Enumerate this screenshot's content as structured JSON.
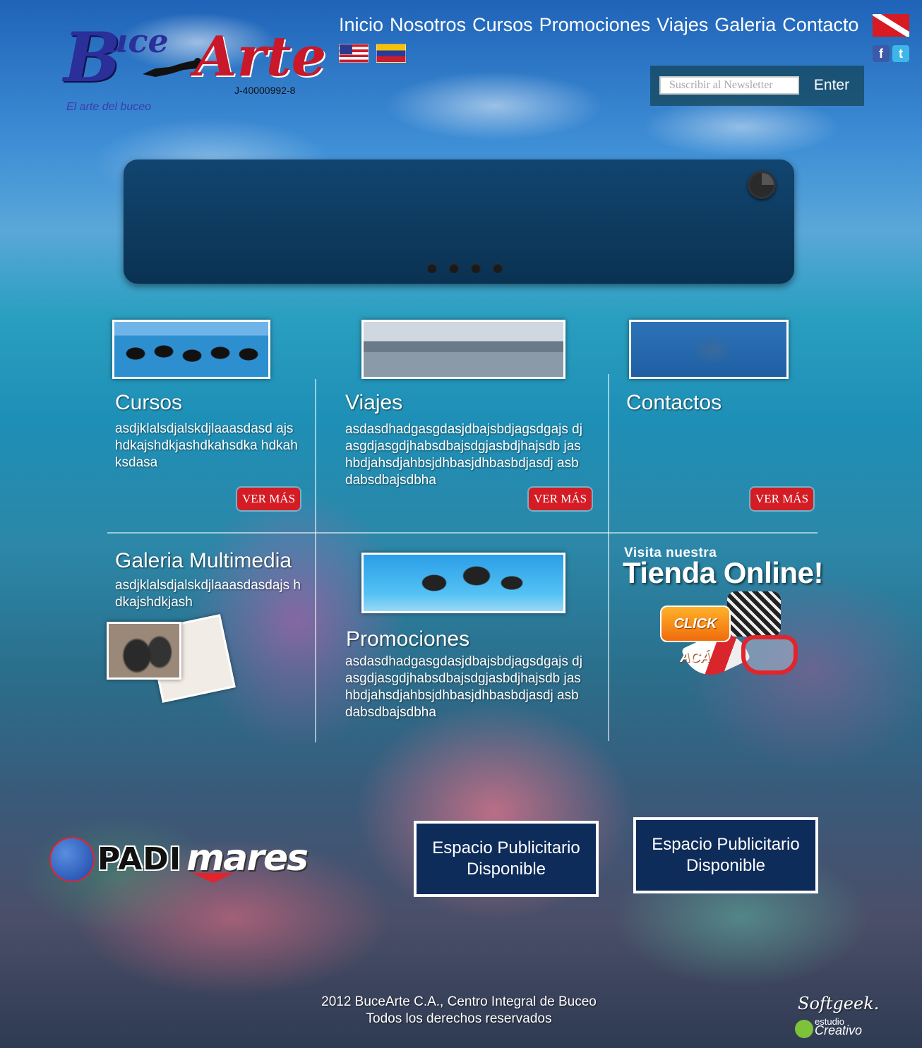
{
  "logo": {
    "brand_b": "B",
    "brand_uce": "uce",
    "brand_arte": "Arte",
    "rif": "J-40000992-8",
    "tagline": "El arte del buceo"
  },
  "nav": [
    "Inicio",
    "Nosotros",
    "Cursos",
    "Promociones",
    "Viajes",
    "Galeria",
    "Contacto"
  ],
  "social": {
    "facebook": "f",
    "twitter": "t"
  },
  "newsletter": {
    "placeholder": "Suscribir al Newsletter",
    "button": "Enter"
  },
  "slider": {
    "dots": 4
  },
  "sections": {
    "cursos": {
      "title": "Cursos",
      "text": "asdjklalsdjalskdjlaaasdasd ajshdkajshdkjashdkahsdka hdkahksdasa",
      "button": "VER MÁS"
    },
    "viajes": {
      "title": "Viajes",
      "text": "asdasdhadgasgdasjdbajsbdjagsdgajs djasgdjasgdjhabsdbajsdgjasbdjhajsdb jashbdjahsdjahbsjdhbasjdhbasbdjasdj asbdabsdbajsdbha",
      "button": "VER MÁS"
    },
    "contactos": {
      "title": "Contactos",
      "button": "VER MÁS"
    },
    "galeria": {
      "title": "Galeria Multimedia",
      "text": "asdjklalsdjalskdjlaaasdasdajs hdkajshdkjash"
    },
    "promociones": {
      "title": "Promociones",
      "text": "asdasdhadgasgdasjdbajsbdjagsdgajs djasgdjasgdjhabsdbajsdgjasbdjhajsdb jashbdjahsdjahbsjdhbasjdhbasbdjasdj asbdabsdbajsdbha"
    }
  },
  "tienda": {
    "small": "Visita nuestra",
    "big": "Tienda Online!",
    "click": "CLICK ACÁ"
  },
  "sponsors": {
    "padi": "PADI",
    "mares": "mares"
  },
  "ads": [
    "Espacio Publicitario Disponible",
    "Espacio Publicitario Disponible"
  ],
  "footer": {
    "line1": "2012 BuceArte C.A., Centro Integral de Buceo",
    "line2": "Todos los derechos reservados"
  },
  "credits": {
    "softgeek": "Softgeek.",
    "estudio": "estudio",
    "creativo": "Creativo"
  }
}
